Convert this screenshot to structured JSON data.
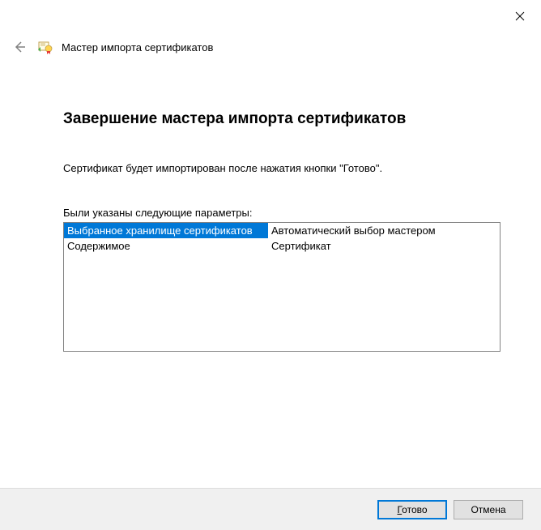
{
  "close_icon": "✕",
  "header": {
    "title": "Мастер импорта сертификатов"
  },
  "main": {
    "heading": "Завершение мастера импорта сертификатов",
    "description": "Сертификат будет импортирован после нажатия кнопки \"Готово\".",
    "params_label": "Были указаны следующие параметры:",
    "rows": [
      {
        "key": "Выбранное хранилище сертификатов",
        "value": "Автоматический выбор мастером",
        "selected": true
      },
      {
        "key": "Содержимое",
        "value": "Сертификат",
        "selected": false
      }
    ]
  },
  "footer": {
    "finish_mnemonic": "Г",
    "finish_rest": "отово",
    "cancel": "Отмена"
  }
}
